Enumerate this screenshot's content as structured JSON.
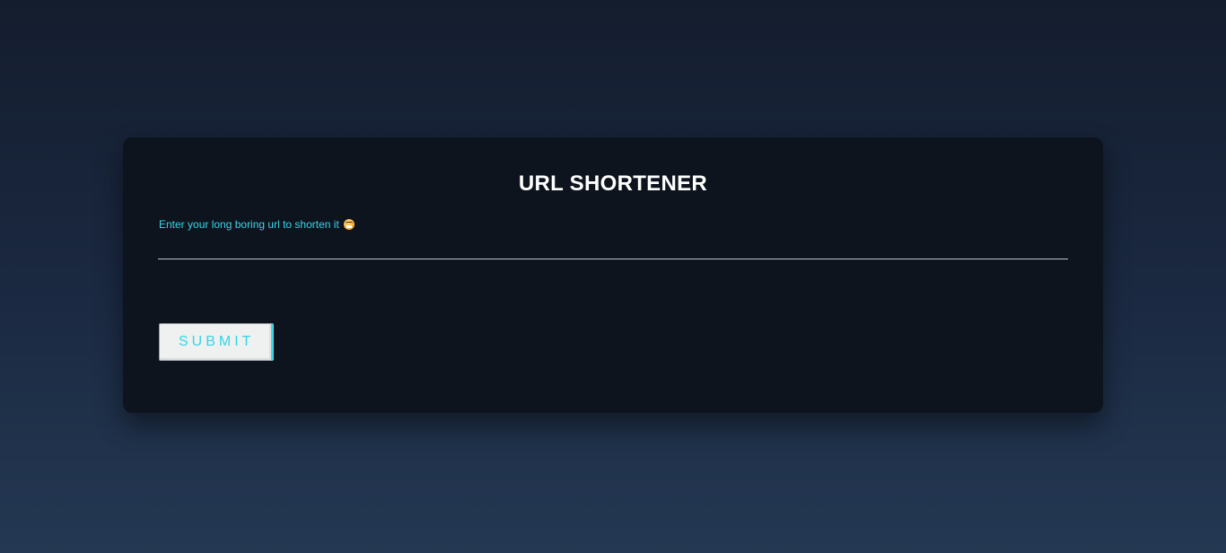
{
  "form": {
    "title": "URL SHORTENER",
    "input_label": "Enter your long boring url to shorten it",
    "label_icon": "grimacing-face-emoji-icon",
    "input_value": "",
    "submit_label": "SUBMIT"
  },
  "colors": {
    "accent": "#35d6e8",
    "card_background": "#0e141e",
    "page_background_top": "#141d2e",
    "page_background_bottom": "#243853",
    "title_text": "#ffffff",
    "button_background": "#eff0f0"
  }
}
